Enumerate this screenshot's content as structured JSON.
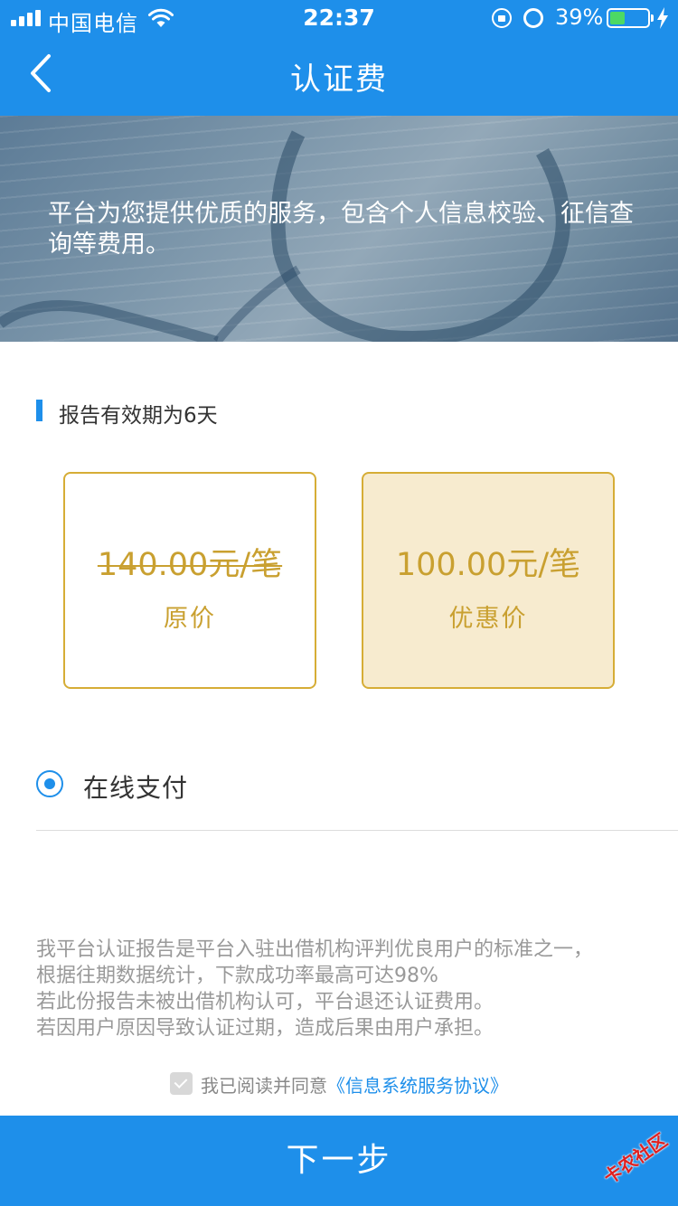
{
  "status_bar": {
    "carrier": "中国电信",
    "time": "22:37",
    "battery_percent": "39%",
    "battery_level": 0.39,
    "icons": [
      "signal-icon",
      "wifi-icon",
      "orientation-lock-icon",
      "alarm-icon",
      "battery-icon",
      "charging-icon"
    ]
  },
  "nav": {
    "title": "认证费",
    "back_icon": "chevron-left-icon"
  },
  "banner": {
    "text": "平台为您提供优质的服务，包含个人信息校验、征信查询等费用。"
  },
  "section": {
    "heading": "报告有效期为6天"
  },
  "prices": {
    "original": {
      "price": "140.00元/笔",
      "label": "原价"
    },
    "discount": {
      "price": "100.00元/笔",
      "label": "优惠价"
    }
  },
  "payment": {
    "label": "在线支付",
    "selected": true
  },
  "notes": [
    "我平台认证报告是平台入驻出借机构评判优良用户的标准之一，",
    "根据往期数据统计，下款成功率最高可达98%",
    "若此份报告未被出借机构认可，平台退还认证费用。",
    "若因用户原因导致认证过期，造成后果由用户承担。"
  ],
  "agreement": {
    "prefix": "我已阅读并同意",
    "link": "《信息系统服务协议》",
    "checked": true
  },
  "footer": {
    "next_label": "下一步"
  },
  "watermark": {
    "text": "卡农社区"
  },
  "colors": {
    "primary": "#1e8fea",
    "gold": "#c9a030",
    "card_border": "#d6ad36",
    "promo_bg": "#f7ebcf",
    "note_text": "#999999"
  }
}
